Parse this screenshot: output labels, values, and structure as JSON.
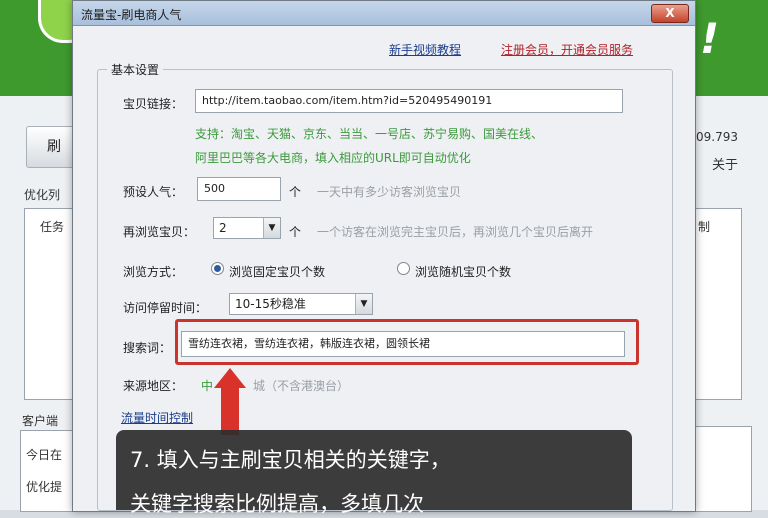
{
  "dialog": {
    "title": "流量宝-刷电商人气",
    "close_label": "X",
    "help_link": "新手视频教程",
    "member_link": "注册会员，开通会员服务",
    "group_title": "基本设置"
  },
  "form": {
    "item_link_label": "宝贝链接：",
    "item_link_value": "http://item.taobao.com/item.htm?id=520495490191",
    "support_line1": "支持：淘宝、天猫、京东、当当、一号店、苏宁易购、国美在线、",
    "support_line2": "阿里巴巴等各大电商，填入相应的URL即可自动优化",
    "target_pop_label": "预设人气：",
    "target_pop_value": "500",
    "target_pop_unit": "个",
    "target_pop_hint": "一天中有多少访客浏览宝贝",
    "extra_browse_label": "再浏览宝贝：",
    "extra_browse_value": "2",
    "extra_browse_unit": "个",
    "extra_browse_hint": "一个访客在浏览完主宝贝后，再浏览几个宝贝后离开",
    "browse_mode_label": "浏览方式：",
    "browse_mode_opt1": "浏览固定宝贝个数",
    "browse_mode_opt2": "浏览随机宝贝个数",
    "stay_label": "访问停留时间：",
    "stay_value": "10-15秒稳准",
    "keyword_label": "搜索词：",
    "keyword_value": "雪纺连衣裙，雪纺连衣裙，韩版连衣裙，圆领长裙",
    "region_label": "来源地区：",
    "region_value": "中",
    "region_note": "城（不含港澳台）",
    "flow_time_link": "流量时间控制"
  },
  "tip": {
    "line1": "7. 填入与主刷宝贝相关的关键字，",
    "line2": "关键字搜索比例提高，多填几次"
  },
  "background": {
    "button_label": "刷",
    "number_text": "09.793",
    "about_text": "关于",
    "optimize_list": "优化列",
    "task_col": "任务",
    "control_col": "制",
    "client_text": "客户端",
    "today_text": "今日在",
    "optimize_text": "优化提"
  }
}
